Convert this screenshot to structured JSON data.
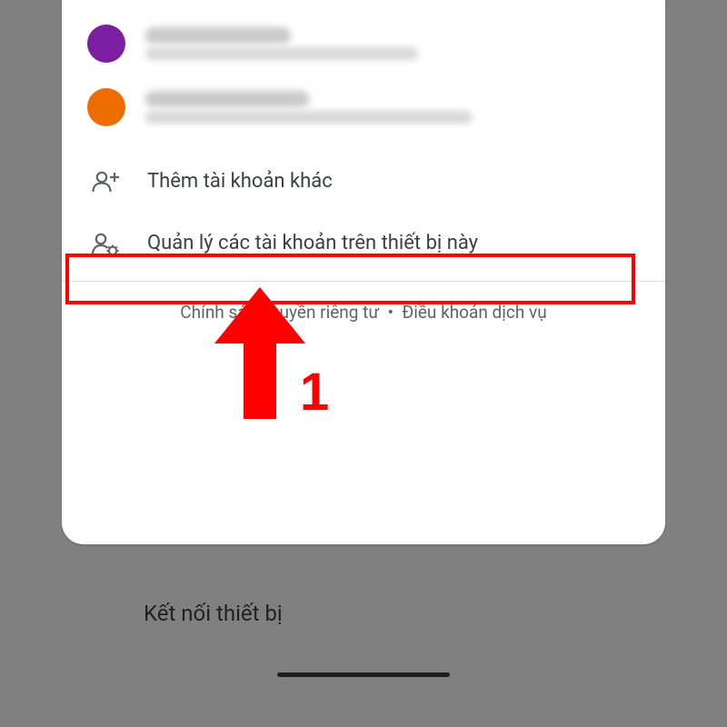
{
  "accounts": [
    {
      "avatar_bg": "#e0e0e0",
      "initial": ""
    },
    {
      "avatar_bg": "#7b1fa2",
      "initial": ""
    },
    {
      "avatar_bg": "#ef6c00",
      "initial": ""
    }
  ],
  "actions": {
    "add_account": "Thêm tài khoản khác",
    "manage_accounts": "Quản lý các tài khoản trên thiết bị này"
  },
  "footer": {
    "privacy": "Chính sách quyền riêng tư",
    "separator": "•",
    "terms": "Điều khoản dịch vụ"
  },
  "background_row": "Kết nối thiết bị",
  "annotation": {
    "step_number": "1"
  },
  "colors": {
    "highlight": "#ff0000",
    "frame_border": "#808080"
  }
}
